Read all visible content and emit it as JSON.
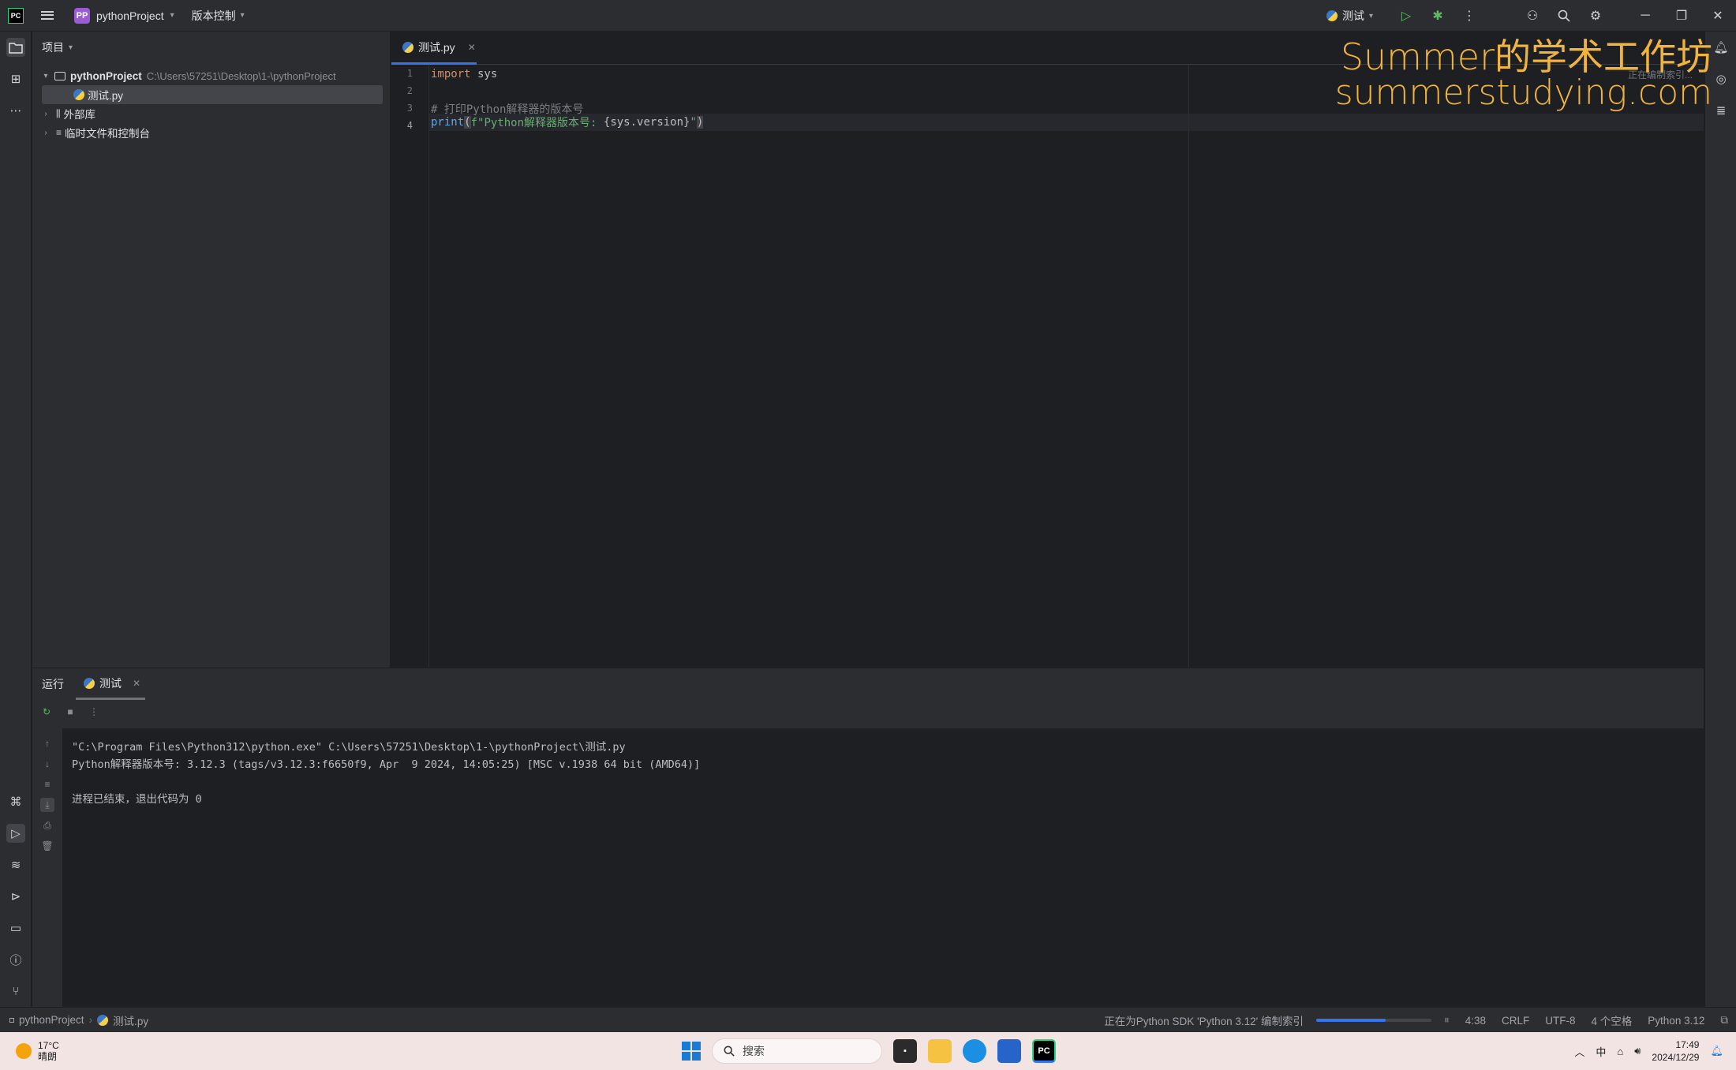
{
  "titlebar": {
    "logo_text": "PC",
    "project_badge": "PP",
    "project_name": "pythonProject",
    "vcs_label": "版本控制",
    "run_config": "测试"
  },
  "project_panel": {
    "header": "项目",
    "root_name": "pythonProject",
    "root_path": "C:\\Users\\57251\\Desktop\\1-\\pythonProject",
    "file_name": "测试.py",
    "external_libs": "外部库",
    "scratches": "临时文件和控制台"
  },
  "editor": {
    "tab_label": "测试.py",
    "indexing_hint": "正在编制索引...",
    "line_numbers": [
      "1",
      "2",
      "3",
      "4"
    ],
    "line1_kw": "import",
    "line1_rest": " sys",
    "line3_comment": "# 打印Python解释器的版本号",
    "line4_fn": "print",
    "line4_paren_open": "(",
    "line4_string": "f\"Python解释器版本号: ",
    "line4_interp": "{sys.version}",
    "line4_string_end": "\"",
    "line4_paren_close": ")"
  },
  "watermark": {
    "line1": "Summer的学术工作坊",
    "line2": "summerstudying.com"
  },
  "run_panel": {
    "title": "运行",
    "tab_label": "测试",
    "console_lines": [
      "\"C:\\Program Files\\Python312\\python.exe\" C:\\Users\\57251\\Desktop\\1-\\pythonProject\\测试.py",
      "Python解释器版本号: 3.12.3 (tags/v3.12.3:f6650f9, Apr  9 2024, 14:05:25) [MSC v.1938 64 bit (AMD64)]",
      "",
      "进程已结束，退出代码为 0"
    ]
  },
  "statusbar": {
    "crumb_project": "pythonProject",
    "crumb_file": "测试.py",
    "indexing_text": "正在为Python SDK 'Python 3.12' 编制索引",
    "indexing_progress": 0.6,
    "cursor_pos": "4:38",
    "line_sep": "CRLF",
    "encoding": "UTF-8",
    "indent": "4 个空格",
    "interpreter": "Python 3.12"
  },
  "taskbar": {
    "temperature": "17°C",
    "weather": "晴朗",
    "search_placeholder": "搜索",
    "tray_ime": "中",
    "time": "17:49",
    "date": "2024/12/29"
  },
  "colors": {
    "accent": "#3574f0",
    "watermark": "#f0b43c",
    "keyword": "#cf8e6d",
    "string": "#6aab73"
  }
}
